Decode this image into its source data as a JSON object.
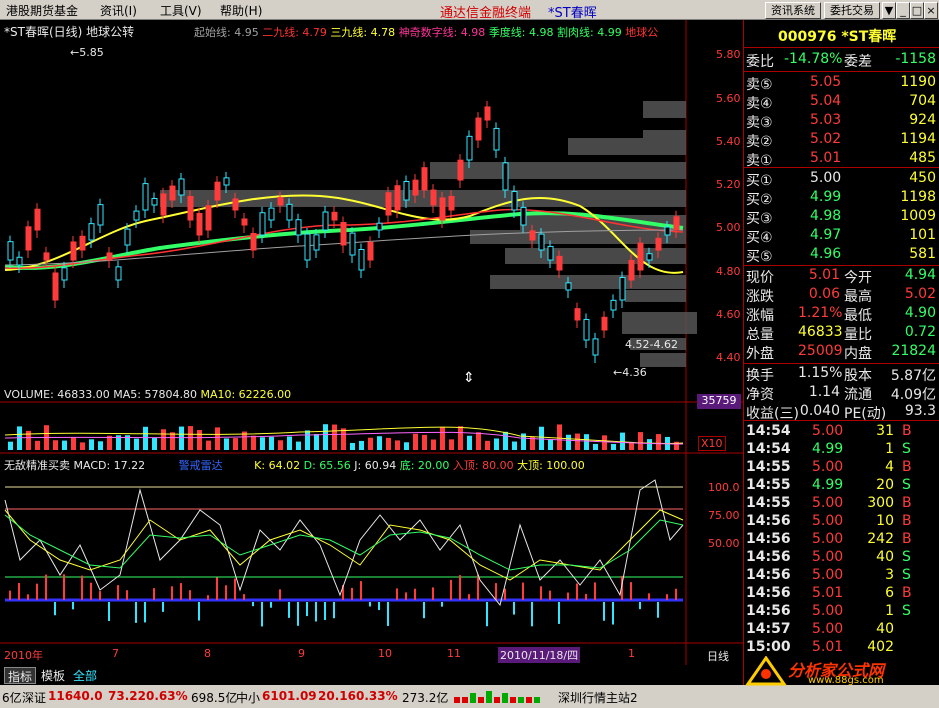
{
  "menubar": {
    "items": [
      "港股期货基金",
      "资讯(I)",
      "工具(V)",
      "帮助(H)"
    ],
    "title": "通达信金融终端",
    "stock_title": "*ST春晖",
    "buttons": [
      "资讯系统",
      "委托交易"
    ],
    "window_buttons": [
      "▼",
      "_",
      "□",
      "×"
    ]
  },
  "chart": {
    "header_name": "*ST春晖(日线) 地球公转",
    "indicators": [
      {
        "label": "起始线: 4.95",
        "color": "#a0a0a0"
      },
      {
        "label": "二九线: 4.79",
        "color": "#ff3333"
      },
      {
        "label": "三九线: 4.78",
        "color": "#ffff33"
      },
      {
        "label": "神奇数字线: 4.98",
        "color": "#ff3399"
      },
      {
        "label": "季度线: 4.98",
        "color": "#33ff66"
      },
      {
        "label": "割肉线: 4.99",
        "color": "#33ff66"
      },
      {
        "label": "地球公",
        "color": "#ff3333"
      }
    ],
    "price_axis": [
      "5.80",
      "5.60",
      "5.40",
      "5.20",
      "5.00",
      "4.80",
      "4.60",
      "4.40"
    ],
    "high_label": "5.85",
    "low_label": "4.36",
    "range_label": "4.52-4.62",
    "volume_header": {
      "volume": "VOLUME: 46833.00",
      "ma5": "MA5: 57804.80",
      "ma10": "MA10: 62226.00"
    },
    "volume_axis_value": "35759",
    "volume_unit": "X10",
    "macd_header": {
      "name": "无敌精准买卖",
      "macd": "MACD: 17.22",
      "alert": "警戒雷达",
      "k": "K: 64.02",
      "d": "D: 65.56",
      "j": "J: 60.94",
      "bottom": "底: 20.00",
      "entry": "入顶: 80.00",
      "top": "大顶: 100.00"
    },
    "macd_axis": [
      "100.0",
      "75.00",
      "50.00"
    ],
    "date_axis": [
      "2010年",
      "7",
      "8",
      "9",
      "10",
      "11",
      "2010/11/18/四",
      "1"
    ],
    "period_label": "日线"
  },
  "tabs": [
    "指标",
    "模板",
    "全部"
  ],
  "quote": {
    "code": "000976",
    "name": "*ST春晖",
    "wei_bi_label": "委比",
    "wei_bi": "-14.78%",
    "wei_cha_label": "委差",
    "wei_cha": "-1158",
    "sells": [
      {
        "label": "卖⑤",
        "price": "5.05",
        "vol": "1190"
      },
      {
        "label": "卖④",
        "price": "5.04",
        "vol": "704"
      },
      {
        "label": "卖③",
        "price": "5.03",
        "vol": "924"
      },
      {
        "label": "卖②",
        "price": "5.02",
        "vol": "1194"
      },
      {
        "label": "卖①",
        "price": "5.01",
        "vol": "485"
      }
    ],
    "buys": [
      {
        "label": "买①",
        "price": "5.00",
        "vol": "450"
      },
      {
        "label": "买②",
        "price": "4.99",
        "vol": "1198"
      },
      {
        "label": "买③",
        "price": "4.98",
        "vol": "1009"
      },
      {
        "label": "买④",
        "price": "4.97",
        "vol": "101"
      },
      {
        "label": "买⑤",
        "price": "4.96",
        "vol": "581"
      }
    ],
    "stats": [
      {
        "l1": "现价",
        "v1": "5.01",
        "c1": "r",
        "l2": "今开",
        "v2": "4.94",
        "c2": "g"
      },
      {
        "l1": "涨跌",
        "v1": "0.06",
        "c1": "r",
        "l2": "最高",
        "v2": "5.02",
        "c2": "r"
      },
      {
        "l1": "涨幅",
        "v1": "1.21%",
        "c1": "r",
        "l2": "最低",
        "v2": "4.90",
        "c2": "g"
      },
      {
        "l1": "总量",
        "v1": "46833",
        "c1": "y",
        "l2": "量比",
        "v2": "0.72",
        "c2": "g"
      },
      {
        "l1": "外盘",
        "v1": "25009",
        "c1": "r",
        "l2": "内盘",
        "v2": "21824",
        "c2": "g"
      }
    ],
    "stats2": [
      {
        "l1": "换手",
        "v1": "1.15%",
        "l2": "股本",
        "v2": "5.87亿"
      },
      {
        "l1": "净资",
        "v1": "1.14",
        "l2": "流通",
        "v2": "4.09亿"
      },
      {
        "l1": "收益(三)",
        "v1": "0.040",
        "l2": "PE(动)",
        "v2": "93.3"
      }
    ],
    "ticks": [
      {
        "t": "14:54",
        "p": "5.00",
        "v": "31",
        "s": "B"
      },
      {
        "t": "14:54",
        "p": "4.99",
        "v": "1",
        "s": "S"
      },
      {
        "t": "14:55",
        "p": "5.00",
        "v": "4",
        "s": "B"
      },
      {
        "t": "14:55",
        "p": "4.99",
        "v": "20",
        "s": "S"
      },
      {
        "t": "14:55",
        "p": "5.00",
        "v": "300",
        "s": "B"
      },
      {
        "t": "14:56",
        "p": "5.00",
        "v": "10",
        "s": "B"
      },
      {
        "t": "14:56",
        "p": "5.00",
        "v": "242",
        "s": "B"
      },
      {
        "t": "14:56",
        "p": "5.00",
        "v": "40",
        "s": "S"
      },
      {
        "t": "14:56",
        "p": "5.00",
        "v": "3",
        "s": "S"
      },
      {
        "t": "14:56",
        "p": "5.01",
        "v": "6",
        "s": "B"
      },
      {
        "t": "14:56",
        "p": "5.00",
        "v": "1",
        "s": "S"
      },
      {
        "t": "14:57",
        "p": "5.00",
        "v": "40",
        "s": ""
      },
      {
        "t": "15:00",
        "p": "5.01",
        "v": "402",
        "s": ""
      }
    ]
  },
  "statusbar": {
    "lead": "6亿",
    "sz_label": "深证",
    "sz_val": "11640.0",
    "sz_chg": "73.22",
    "sz_pct": "0.63%",
    "sz_amt": "698.5亿",
    "zx_label": "中小",
    "zx_val": "6101.09",
    "zx_chg": "20.16",
    "zx_pct": "0.33%",
    "zx_amt": "273.2亿",
    "server": "深圳行情主站2"
  },
  "watermark": {
    "text": "分析家公式网",
    "url": "www.88gs.com"
  }
}
